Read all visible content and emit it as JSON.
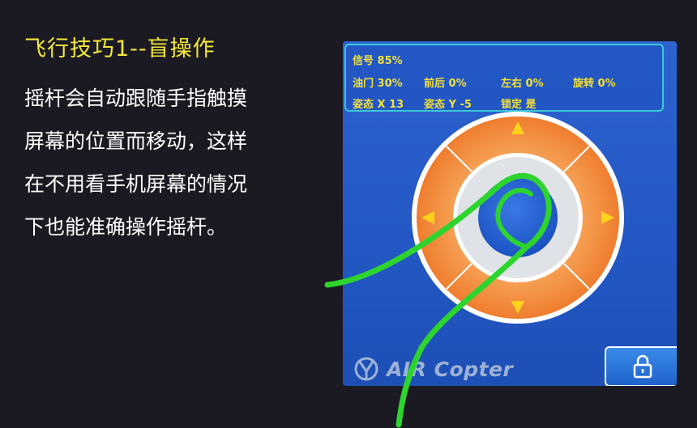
{
  "slide": {
    "title": "飞行技巧1--盲操作",
    "body_lines": [
      "摇杆会自动跟随手指触摸",
      "屏幕的位置而移动，这样",
      "在不用看手机屏幕的情况",
      "下也能准确操作摇杆。"
    ]
  },
  "app": {
    "status": {
      "signal": "信号 85%",
      "throttle": "油门 30%",
      "pitch": "前后 0%",
      "roll": "左右 0%",
      "yaw": "旋转 0%",
      "attitude_x": "姿态 X 13",
      "attitude_y": "姿态 Y -5",
      "lock": "锁定 是"
    },
    "brand": "AIR Copter",
    "lock_icon": "lock-icon",
    "joystick_arrows": [
      "arrow-up-icon",
      "arrow-down-icon",
      "arrow-left-icon",
      "arrow-right-icon"
    ]
  },
  "colors": {
    "background": "#1b1a22",
    "title": "#f5e83a",
    "phone_bg": "#2a5fcb",
    "status_text": "#f2e03a",
    "status_border": "#3bc9d8",
    "ring_orange": "#f08a3c",
    "arrow_yellow": "#ffd21e",
    "finger_trace": "#2ed42e"
  }
}
